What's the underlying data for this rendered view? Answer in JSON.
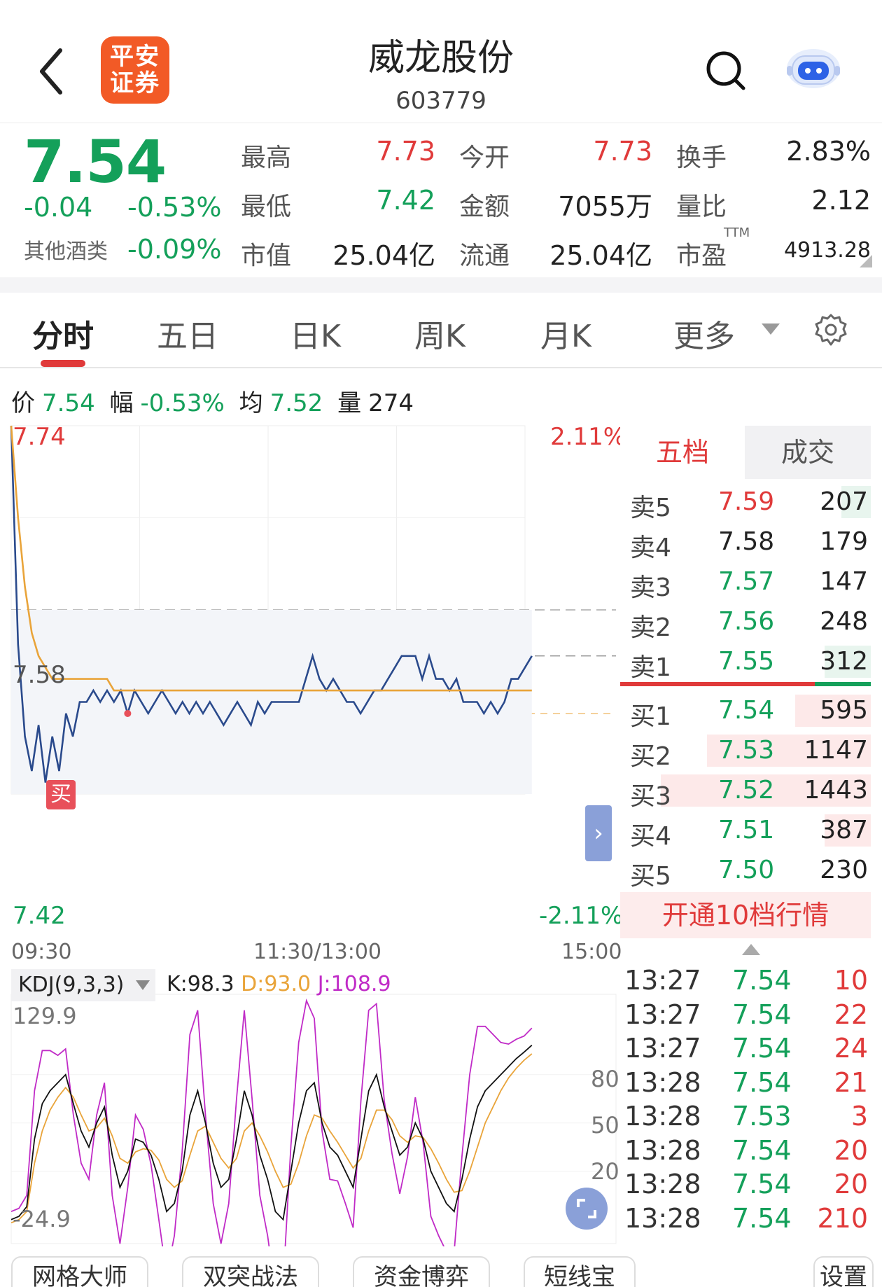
{
  "header": {
    "logo_text": "平安证券",
    "stock_name": "威龙股份",
    "stock_code": "603779"
  },
  "quote": {
    "price": "7.54",
    "change": "-0.04",
    "change_pct": "-0.53%",
    "sector_name": "其他酒类",
    "sector_pct": "-0.09%",
    "high_label": "最高",
    "high": "7.73",
    "low_label": "最低",
    "low": "7.42",
    "mcap_label": "市值",
    "mcap": "25.04亿",
    "open_label": "今开",
    "open": "7.73",
    "amount_label": "金额",
    "amount": "7055万",
    "float_label": "流通",
    "float_cap": "25.04亿",
    "turnover_label": "换手",
    "turnover": "2.83%",
    "vol_ratio_label": "量比",
    "vol_ratio": "2.12",
    "pe_label": "市盈",
    "pe_sup": "TTM",
    "pe": "4913.28"
  },
  "tabs": [
    "分时",
    "五日",
    "日K",
    "周K",
    "月K",
    "更多"
  ],
  "infobar": {
    "price_label": "价",
    "price": "7.54",
    "range_label": "幅",
    "range": "-0.53%",
    "avg_label": "均",
    "avg": "7.52",
    "vol_label": "量",
    "vol": "274"
  },
  "chart_data": {
    "type": "line",
    "title": "",
    "y_top_label": "7.74",
    "y_mid_label": "7.58",
    "y_bottom_label": "7.42",
    "pct_top_label": "2.11%",
    "pct_bottom_label": "-2.11%",
    "x_labels": [
      "09:30",
      "11:30/13:00",
      "15:00"
    ],
    "ylim": [
      7.42,
      7.74
    ],
    "prev_close": 7.58,
    "buy_marker": "买",
    "series": [
      {
        "name": "价",
        "color": "#2a4a8c",
        "values": [
          7.74,
          7.55,
          7.47,
          7.44,
          7.48,
          7.43,
          7.47,
          7.44,
          7.49,
          7.47,
          7.5,
          7.5,
          7.51,
          7.5,
          7.51,
          7.5,
          7.51,
          7.49,
          7.51,
          7.5,
          7.49,
          7.5,
          7.51,
          7.5,
          7.49,
          7.5,
          7.49,
          7.5,
          7.49,
          7.5,
          7.49,
          7.48,
          7.49,
          7.5,
          7.49,
          7.48,
          7.5,
          7.49,
          7.5,
          7.5,
          7.5,
          7.5,
          7.5,
          7.52,
          7.54,
          7.52,
          7.51,
          7.52,
          7.51,
          7.5,
          7.5,
          7.49,
          7.5,
          7.51,
          7.51,
          7.52,
          7.53,
          7.54,
          7.54,
          7.54,
          7.52,
          7.54,
          7.52,
          7.52,
          7.51,
          7.52,
          7.5,
          7.5,
          7.5,
          7.49,
          7.5,
          7.49,
          7.5,
          7.52,
          7.52,
          7.53,
          7.54
        ]
      },
      {
        "name": "均",
        "color": "#e9a43a",
        "values": [
          7.74,
          7.66,
          7.6,
          7.56,
          7.54,
          7.53,
          7.52,
          7.52,
          7.52,
          7.52,
          7.52,
          7.52,
          7.52,
          7.52,
          7.52,
          7.51,
          7.51,
          7.51,
          7.51,
          7.51,
          7.51,
          7.51,
          7.51,
          7.51,
          7.51,
          7.51,
          7.51,
          7.51,
          7.51,
          7.51,
          7.51,
          7.51,
          7.51,
          7.51,
          7.51,
          7.51,
          7.51,
          7.51,
          7.51,
          7.51,
          7.51,
          7.51,
          7.51,
          7.51,
          7.51,
          7.51,
          7.51,
          7.51,
          7.51,
          7.51,
          7.51,
          7.51,
          7.51,
          7.51,
          7.51,
          7.51,
          7.51,
          7.51,
          7.51,
          7.51,
          7.51,
          7.51,
          7.51,
          7.51,
          7.51,
          7.51,
          7.51,
          7.51,
          7.51,
          7.51,
          7.51,
          7.51,
          7.51,
          7.51,
          7.51,
          7.51,
          7.51
        ]
      }
    ]
  },
  "kdj": {
    "selector": "KDJ(9,3,3)",
    "k_text": "K:98.3",
    "d_text": "D:93.0",
    "j_text": "J:108.9",
    "y_top": "129.9",
    "y_bottom": "-24.9",
    "levels": [
      "80",
      "50",
      "20"
    ],
    "ylim": [
      -24.9,
      129.9
    ],
    "k_color": "#111111",
    "d_color": "#e9a43a",
    "j_color": "#c02bc7",
    "k_values": [
      -10,
      -8,
      -2,
      40,
      62,
      70,
      75,
      80,
      62,
      45,
      35,
      50,
      60,
      30,
      10,
      20,
      40,
      38,
      30,
      15,
      -5,
      0,
      20,
      55,
      70,
      50,
      25,
      10,
      15,
      40,
      70,
      55,
      30,
      15,
      -5,
      -10,
      20,
      50,
      70,
      75,
      50,
      35,
      30,
      20,
      10,
      40,
      70,
      80,
      60,
      45,
      30,
      35,
      50,
      40,
      20,
      10,
      0,
      -5,
      15,
      40,
      60,
      70,
      75,
      80,
      85,
      90,
      94,
      98.3
    ],
    "d_values": [
      -12,
      -10,
      -5,
      25,
      45,
      58,
      66,
      72,
      66,
      55,
      45,
      47,
      53,
      42,
      28,
      25,
      32,
      34,
      33,
      27,
      15,
      10,
      14,
      30,
      45,
      48,
      38,
      28,
      22,
      28,
      45,
      50,
      42,
      32,
      20,
      10,
      12,
      25,
      42,
      55,
      53,
      45,
      38,
      30,
      22,
      28,
      45,
      58,
      58,
      52,
      42,
      38,
      42,
      41,
      34,
      25,
      15,
      7,
      8,
      20,
      35,
      50,
      60,
      70,
      78,
      84,
      89,
      93.0
    ],
    "j_values": [
      -5,
      -3,
      5,
      70,
      95,
      95,
      92,
      96,
      55,
      25,
      15,
      55,
      75,
      5,
      -25,
      10,
      55,
      46,
      24,
      -10,
      -45,
      -20,
      32,
      105,
      120,
      55,
      0,
      -25,
      0,
      65,
      120,
      65,
      5,
      -20,
      -55,
      -50,
      36,
      100,
      126,
      115,
      45,
      15,
      14,
      0,
      -15,
      64,
      120,
      124,
      64,
      31,
      6,
      29,
      66,
      38,
      -8,
      -20,
      -30,
      -30,
      29,
      80,
      110,
      110,
      105,
      100,
      99,
      102,
      104,
      108.9
    ]
  },
  "order_book": {
    "tab_five": "五档",
    "tab_deal": "成交",
    "asks": [
      {
        "label": "卖5",
        "price": "7.59",
        "vol": "207",
        "color": "#e03a3a",
        "bar": 0.14
      },
      {
        "label": "卖4",
        "price": "7.58",
        "vol": "179",
        "color": "#222222",
        "bar": 0.0
      },
      {
        "label": "卖3",
        "price": "7.57",
        "vol": "147",
        "color": "#14a05a",
        "bar": 0.0
      },
      {
        "label": "卖2",
        "price": "7.56",
        "vol": "248",
        "color": "#14a05a",
        "bar": 0.0
      },
      {
        "label": "卖1",
        "price": "7.55",
        "vol": "312",
        "color": "#14a05a",
        "bar": 0.22
      }
    ],
    "bids": [
      {
        "label": "买1",
        "price": "7.54",
        "vol": "595",
        "color": "#14a05a",
        "bar": 0.36
      },
      {
        "label": "买2",
        "price": "7.53",
        "vol": "1147",
        "color": "#14a05a",
        "bar": 0.78
      },
      {
        "label": "买3",
        "price": "7.52",
        "vol": "1443",
        "color": "#14a05a",
        "bar": 1.0
      },
      {
        "label": "买4",
        "price": "7.51",
        "vol": "387",
        "color": "#14a05a",
        "bar": 0.22
      },
      {
        "label": "买5",
        "price": "7.50",
        "vol": "230",
        "color": "#14a05a",
        "bar": 0.0
      }
    ],
    "open10": "开通10档行情"
  },
  "trades": [
    {
      "time": "13:27",
      "price": "7.54",
      "vol": "10"
    },
    {
      "time": "13:27",
      "price": "7.54",
      "vol": "22"
    },
    {
      "time": "13:27",
      "price": "7.54",
      "vol": "24"
    },
    {
      "time": "13:28",
      "price": "7.54",
      "vol": "21"
    },
    {
      "time": "13:28",
      "price": "7.53",
      "vol": "3"
    },
    {
      "time": "13:28",
      "price": "7.54",
      "vol": "20"
    },
    {
      "time": "13:28",
      "price": "7.54",
      "vol": "20"
    },
    {
      "time": "13:28",
      "price": "7.54",
      "vol": "210"
    }
  ],
  "tools": [
    "网格大师",
    "双突战法",
    "资金博弈",
    "短线宝",
    "设置"
  ],
  "colors": {
    "red": "#e03a3a",
    "green": "#14a05a",
    "brand": "#f25a26"
  }
}
